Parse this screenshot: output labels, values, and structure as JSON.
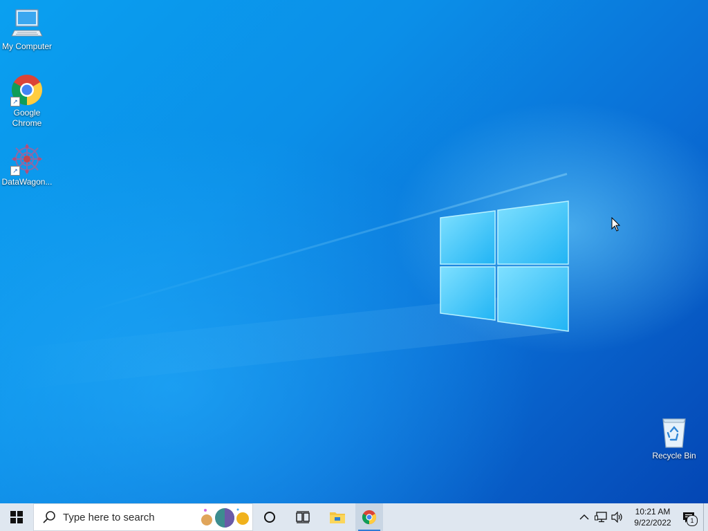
{
  "desktop": {
    "icons": [
      {
        "label": "My Computer",
        "icon": "computer-icon"
      },
      {
        "label": "Google\nChrome",
        "icon": "chrome-icon",
        "shortcut": true
      },
      {
        "label": "DataWagon...",
        "icon": "datawagon-icon",
        "shortcut": true
      }
    ],
    "recycle_bin": {
      "label": "Recycle Bin",
      "icon": "recycle-bin-icon"
    },
    "accent_color": "#0a8ae6"
  },
  "taskbar": {
    "start_icon": "windows-start-icon",
    "search": {
      "placeholder": "Type here to search",
      "icon": "search-icon"
    },
    "cortana_icon": "cortana-circle-icon",
    "task_view_icon": "task-view-icon",
    "pinned": [
      {
        "name": "File Explorer",
        "icon": "folder-icon",
        "active": false
      },
      {
        "name": "Google Chrome",
        "icon": "chrome-icon",
        "active": true
      }
    ],
    "tray": {
      "chevron_icon": "chevron-up-icon",
      "network_icon": "network-icon",
      "volume_icon": "volume-icon",
      "time": "10:21 AM",
      "date": "9/22/2022",
      "notifications_icon": "action-center-icon",
      "notification_count": "1"
    },
    "background": "#dfe7f0",
    "active_indicator": "#2e7bd6"
  }
}
